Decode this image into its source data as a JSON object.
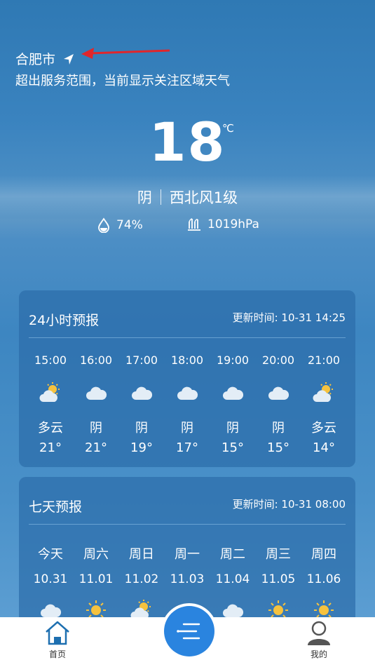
{
  "location": {
    "city": "合肥市",
    "notice": "超出服务范围，当前显示关注区域天气"
  },
  "current": {
    "temperature": "18",
    "unit": "℃",
    "condition": "阴",
    "wind": "西北风1级",
    "humidity": "74%",
    "pressure": "1019hPa"
  },
  "hourly": {
    "title": "24小时预报",
    "updated": "更新时间: 10-31 14:25",
    "items": [
      {
        "time": "15:00",
        "icon": "partly-cloudy-icon",
        "desc": "多云",
        "temp": "21°"
      },
      {
        "time": "16:00",
        "icon": "cloud-icon",
        "desc": "阴",
        "temp": "21°"
      },
      {
        "time": "17:00",
        "icon": "cloud-icon",
        "desc": "阴",
        "temp": "19°"
      },
      {
        "time": "18:00",
        "icon": "cloud-icon",
        "desc": "阴",
        "temp": "17°"
      },
      {
        "time": "19:00",
        "icon": "cloud-icon",
        "desc": "阴",
        "temp": "15°"
      },
      {
        "time": "20:00",
        "icon": "cloud-icon",
        "desc": "阴",
        "temp": "15°"
      },
      {
        "time": "21:00",
        "icon": "partly-cloudy-icon",
        "desc": "多云",
        "temp": "14°"
      }
    ]
  },
  "weekly": {
    "title": "七天预报",
    "updated": "更新时间: 10-31 08:00",
    "items": [
      {
        "day": "今天",
        "date": "10.31",
        "icon": "cloud-icon"
      },
      {
        "day": "周六",
        "date": "11.01",
        "icon": "sun-icon"
      },
      {
        "day": "周日",
        "date": "11.02",
        "icon": "partly-cloudy-icon"
      },
      {
        "day": "周一",
        "date": "11.03",
        "icon": "cloud-icon"
      },
      {
        "day": "周二",
        "date": "11.04",
        "icon": "cloud-icon"
      },
      {
        "day": "周三",
        "date": "11.05",
        "icon": "sun-icon"
      },
      {
        "day": "周四",
        "date": "11.06",
        "icon": "sun-icon"
      }
    ]
  },
  "tabs": {
    "home": "首页",
    "mine": "我的"
  },
  "colors": {
    "accent": "#2a84df",
    "annotation": "#e0262b"
  }
}
